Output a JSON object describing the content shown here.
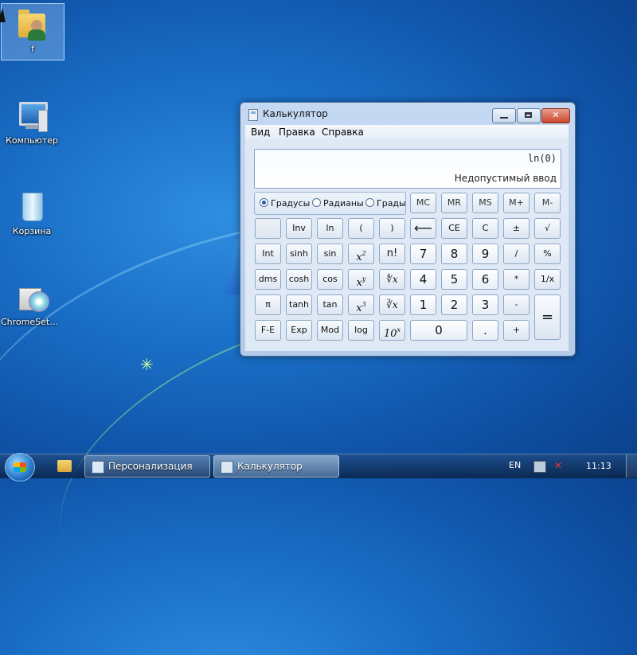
{
  "desktop": {
    "icons": [
      {
        "label": "f",
        "icon": "user-folder-icon"
      },
      {
        "label": "Компьютер",
        "icon": "computer-icon"
      },
      {
        "label": "Корзина",
        "icon": "recycle-bin-icon"
      },
      {
        "label": "ChromeSetu...",
        "icon": "installer-icon"
      }
    ]
  },
  "calculator": {
    "title": "Калькулятор",
    "window_buttons": {
      "minimize": "minimize-icon",
      "maximize": "maximize-icon",
      "close": "✕"
    },
    "menu": [
      "Вид",
      "Правка",
      "Справка"
    ],
    "display": {
      "expression": "ln(0)",
      "result": "Недопустимый ввод"
    },
    "angle_units": {
      "options": [
        "Градусы",
        "Радианы",
        "Грады"
      ],
      "selected": "Градусы"
    },
    "keys": {
      "mc": "MC",
      "mr": "MR",
      "ms": "MS",
      "mplus": "M+",
      "mminus": "M-",
      "inv": "Inv",
      "ln": "ln",
      "lparen": "(",
      "rparen": ")",
      "backspace": "⟵",
      "ce": "CE",
      "c": "C",
      "plusminus": "±",
      "sqrt": "√",
      "int": "Int",
      "sinh": "sinh",
      "sin": "sin",
      "x2_base": "x",
      "x2_exp": "2",
      "fact": "n!",
      "n7": "7",
      "n8": "8",
      "n9": "9",
      "div": "/",
      "percent": "%",
      "dms": "dms",
      "cosh": "cosh",
      "cos": "cos",
      "xy_base": "x",
      "xy_exp": "y",
      "yroot": "∜x",
      "n4": "4",
      "n5": "5",
      "n6": "6",
      "mul": "*",
      "recip": "1/x",
      "pi": "π",
      "tanh": "tanh",
      "tan": "tan",
      "x3_base": "x",
      "x3_exp": "3",
      "root3": "∛x",
      "n1": "1",
      "n2": "2",
      "n3": "3",
      "minus": "-",
      "equals": "=",
      "fe": "F-E",
      "exp": "Exp",
      "mod": "Mod",
      "log": "log",
      "tenx_base": "10",
      "tenx_exp": "x",
      "n0": "0",
      "dot": ".",
      "plus": "+"
    }
  },
  "taskbar": {
    "buttons": [
      {
        "label": "Персонализация",
        "icon": "personalization-icon"
      },
      {
        "label": "Калькулятор",
        "icon": "calculator-icon",
        "active": true
      }
    ],
    "language": "EN",
    "time": "11:13",
    "tray_icons": [
      "network-icon",
      "volume-muted-icon"
    ]
  }
}
